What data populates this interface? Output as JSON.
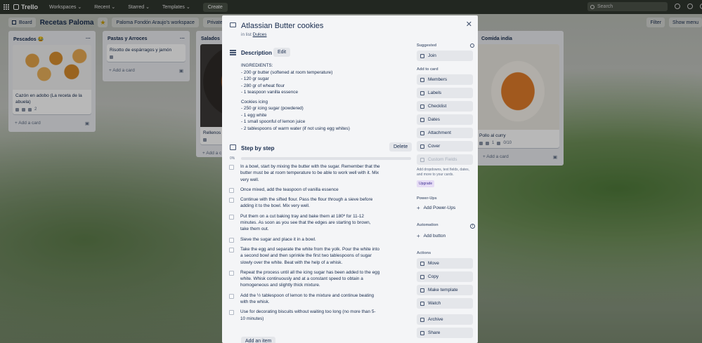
{
  "topbar": {
    "logo": "Trello",
    "menu": [
      "Workspaces ⌄",
      "Recent ⌄",
      "Starred ⌄",
      "Templates ⌄"
    ],
    "create": "Create",
    "search_placeholder": "Search"
  },
  "board": {
    "view": "Board",
    "title": "Recetas Paloma",
    "workspace": "Paloma Fondón Araujo's workspace",
    "visibility": "Private",
    "right_buttons": [
      "Filter",
      "Show menu"
    ]
  },
  "lists": [
    {
      "title": "Pescados",
      "emoji": "😂",
      "card": "Cazón en adobo (La receta de la abuela)",
      "badge_count": "2",
      "add": "+ Add a card"
    },
    {
      "title": "Pastas y Arroces",
      "card": "Risotto de espárragos y jamón",
      "add": "+ Add a card"
    },
    {
      "title": "Salados",
      "card": "Rellenos pa",
      "add": "+ Add a c"
    },
    {
      "title": "Comida india",
      "card": "Pollo al curry",
      "badge_count": "1",
      "badge_checklist": "0/10",
      "add": "+ Add a card"
    }
  ],
  "card": {
    "title": "Atlassian Butter cookies",
    "in_list_prefix": "in list",
    "list_name": "Dulces",
    "description_label": "Description",
    "edit_label": "Edit",
    "description": [
      "INGREDIENTS:",
      "- 200 gr butter (softened at room temperature)",
      "- 120 gr sugar",
      "- 280 gr of wheat flour",
      "- 1 teaspoon vanilla essence",
      "",
      "Cookies icing",
      "- 250 gr icing sugar (powdered)",
      "- 1 egg white",
      "- 1 small spoonful of lemon juice",
      "- 2 tablespoons of warm water (if not using egg whites)"
    ],
    "checklist": {
      "title": "Step by step",
      "delete_label": "Delete",
      "progress": "0%",
      "progress_value": 0,
      "items": [
        "In a bowl, start by mixing the butter with the sugar. Remember that the butter must be at room temperature to be able to work well with it. Mix very well.",
        "Once mixed, add the teaspoon of vanilla essence",
        "Continue with the sifted flour. Pass the flour through a sieve before adding it to the bowl. Mix very well.",
        "Put them on a cut baking tray and bake them at 180º for 11-12 minutes. As soon as you see that the edges are starting to brown, take them out.",
        "Sieve the sugar and place it in a bowl.",
        "Take the egg and separate the white from the yolk. Pour the white into a second bowl and then sprinkle the first two tablespoons of sugar slowly over the white. Beat with the help of a whisk.",
        "Repeat the process until all the icing sugar has been added to the egg white. Whisk continuously and at a constant speed to obtain a homogeneous and slightly thick mixture.",
        "Add the ½ tablespoon of lemon to the mixture and continue beating with the whisk.",
        "Use for decorating biscuits without waiting too long (no more than 5-10 minutes)"
      ],
      "add_item": "Add an item"
    }
  },
  "sidebar": {
    "suggested_label": "Suggested",
    "join": "Join",
    "add_to_card_label": "Add to card",
    "add_to_card": [
      "Members",
      "Labels",
      "Checklist",
      "Dates",
      "Attachment",
      "Cover"
    ],
    "custom_fields": "Custom Fields",
    "custom_fields_note": "Add dropdowns, text fields, dates, and more to your cards.",
    "upgrade": "Upgrade",
    "powerups_label": "Power-Ups",
    "add_powerups": "Add Power-Ups",
    "automation_label": "Automation",
    "add_button": "Add button",
    "actions_label": "Actions",
    "actions": [
      "Move",
      "Copy",
      "Make template",
      "Watch",
      "Archive",
      "Share"
    ]
  }
}
